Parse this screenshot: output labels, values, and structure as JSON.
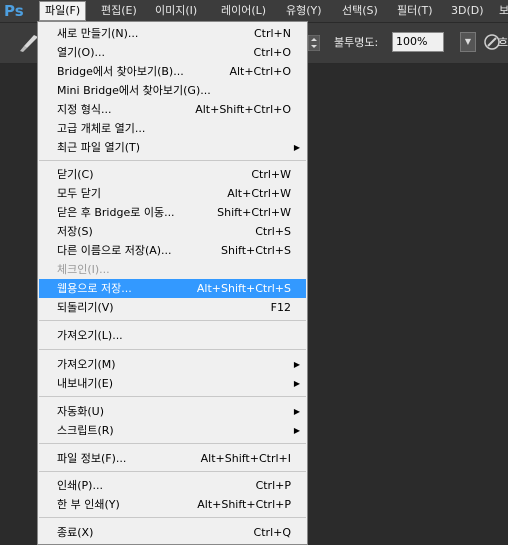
{
  "menubar": {
    "logo": "Ps",
    "items": [
      {
        "label": "파일(F)",
        "active": true
      },
      {
        "label": "편집(E)"
      },
      {
        "label": "이미지(I)"
      },
      {
        "label": "레이어(L)"
      },
      {
        "label": "유형(Y)"
      },
      {
        "label": "선택(S)"
      },
      {
        "label": "필터(T)"
      },
      {
        "label": "3D(D)"
      },
      {
        "label": "보"
      }
    ]
  },
  "options": {
    "opacity_label": "불투명도:",
    "opacity_value": "100%",
    "more": "흐"
  },
  "file_menu": {
    "items": [
      {
        "label": "새로 만들기(N)...",
        "shortcut": "Ctrl+N"
      },
      {
        "label": "열기(O)...",
        "shortcut": "Ctrl+O"
      },
      {
        "label": "Bridge에서 찾아보기(B)...",
        "shortcut": "Alt+Ctrl+O"
      },
      {
        "label": "Mini Bridge에서 찾아보기(G)...",
        "shortcut": ""
      },
      {
        "label": "지정 형식...",
        "shortcut": "Alt+Shift+Ctrl+O"
      },
      {
        "label": "고급 개체로 열기...",
        "shortcut": ""
      },
      {
        "label": "최근 파일 열기(T)",
        "shortcut": "",
        "submenu": true
      },
      {
        "label": "닫기(C)",
        "shortcut": "Ctrl+W"
      },
      {
        "label": "모두 닫기",
        "shortcut": "Alt+Ctrl+W"
      },
      {
        "label": "닫은 후 Bridge로 이동...",
        "shortcut": "Shift+Ctrl+W"
      },
      {
        "label": "저장(S)",
        "shortcut": "Ctrl+S"
      },
      {
        "label": "다른 이름으로 저장(A)...",
        "shortcut": "Shift+Ctrl+S"
      },
      {
        "label": "체크인(I)...",
        "shortcut": "",
        "disabled": true
      },
      {
        "label": "웹용으로 저장...",
        "shortcut": "Alt+Shift+Ctrl+S",
        "highlighted": true
      },
      {
        "label": "되돌리기(V)",
        "shortcut": "F12"
      },
      {
        "label": "가져오기(L)...",
        "shortcut": ""
      },
      {
        "label": "가져오기(M)",
        "shortcut": "",
        "submenu": true
      },
      {
        "label": "내보내기(E)",
        "shortcut": "",
        "submenu": true
      },
      {
        "label": "자동화(U)",
        "shortcut": "",
        "submenu": true
      },
      {
        "label": "스크립트(R)",
        "shortcut": "",
        "submenu": true
      },
      {
        "label": "파일 정보(F)...",
        "shortcut": "Alt+Shift+Ctrl+I"
      },
      {
        "label": "인쇄(P)...",
        "shortcut": "Ctrl+P"
      },
      {
        "label": "한 부 인쇄(Y)",
        "shortcut": "Alt+Shift+Ctrl+P"
      },
      {
        "label": "종료(X)",
        "shortcut": "Ctrl+Q"
      }
    ]
  }
}
